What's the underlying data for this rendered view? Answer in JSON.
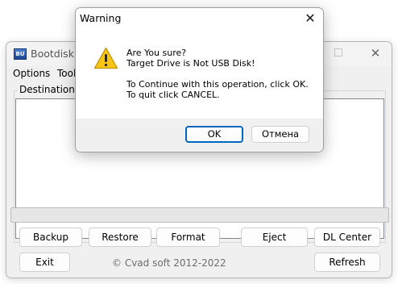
{
  "main_window": {
    "title": "Bootdisk U",
    "icon_text": "BU",
    "menu": [
      "Options",
      "Tools"
    ],
    "group_label": "Destination Di",
    "buttons": {
      "backup": "Backup",
      "restore": "Restore",
      "format": "Format",
      "eject": "Eject",
      "dl_center": "DL Center",
      "exit": "Exit",
      "refresh": "Refresh"
    },
    "copyright": "© Cvad soft 2012-2022",
    "progress": 0
  },
  "dialog": {
    "title": "Warning",
    "lines": [
      "Are You sure?",
      "Target Drive is Not USB Disk!",
      "",
      "To Continue with this operation, click OK.",
      "To quit click CANCEL."
    ],
    "ok_label": "OK",
    "cancel_label": "Отмена",
    "icon": "warning-icon"
  },
  "colors": {
    "accent": "#0067c0",
    "warning_yellow": "#f9c515"
  }
}
